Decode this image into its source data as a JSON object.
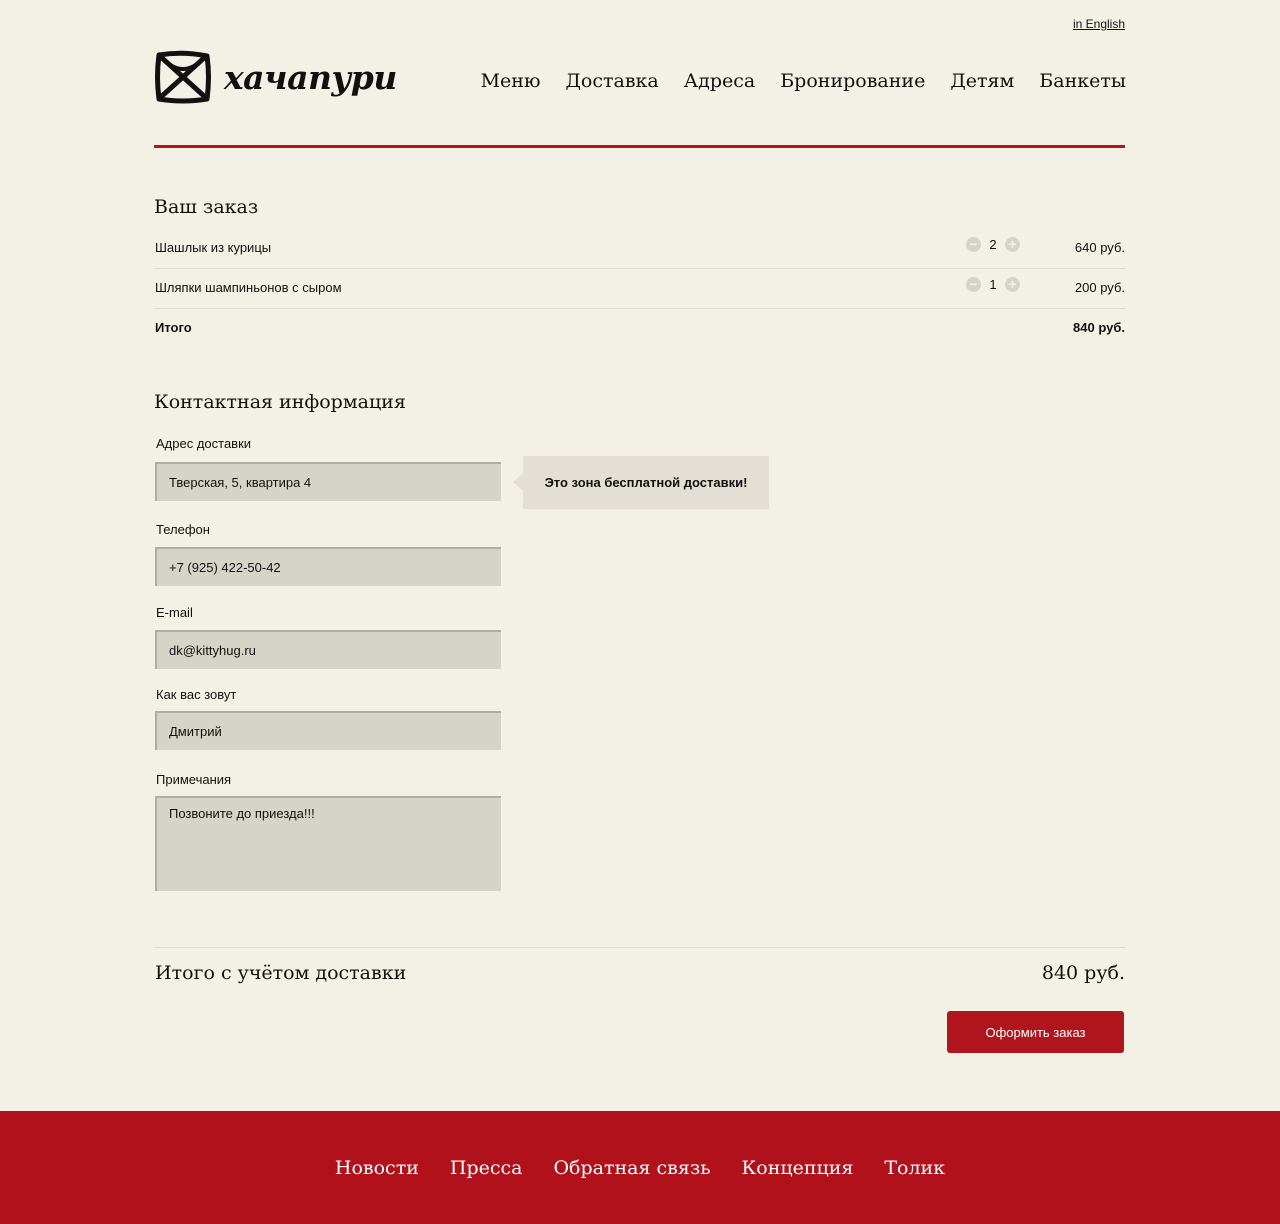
{
  "header": {
    "lang_link": "in English",
    "logo_text": "хачапури",
    "nav": [
      "Меню",
      "Доставка",
      "Адреса",
      "Бронирование",
      "Детям",
      "Банкеты"
    ]
  },
  "order": {
    "title": "Ваш заказ",
    "items": [
      {
        "name": "Шашлык из курицы",
        "qty": "2",
        "price": "640 руб."
      },
      {
        "name": "Шляпки шампиньонов с сыром",
        "qty": "1",
        "price": "200 руб."
      }
    ],
    "total_label": "Итого",
    "total_value": "840 руб."
  },
  "contact": {
    "title": "Контактная информация",
    "address_label": "Адрес доставки",
    "address_value": "Тверская, 5, квартира 4",
    "tooltip": "Это зона бесплатной доставки!",
    "phone_label": "Телефон",
    "phone_value": "+7 (925) 422-50-42",
    "email_label": "E-mail",
    "email_value": "dk@kittyhug.ru",
    "name_label": "Как вас зовут",
    "name_value": "Дмитрий",
    "notes_label": "Примечания",
    "notes_value": "Позвоните до приезда!!!"
  },
  "summary": {
    "grand_label": "Итого с учётом доставки",
    "grand_value": "840 руб.",
    "submit_label": "Оформить заказ"
  },
  "footer": {
    "nav": [
      "Новости",
      "Пресса",
      "Обратная связь",
      "Концепция",
      "Толик"
    ]
  },
  "colors": {
    "background": "#f3f0e5",
    "accent_red": "#b0111a",
    "field_bg": "#d6d3c8"
  }
}
